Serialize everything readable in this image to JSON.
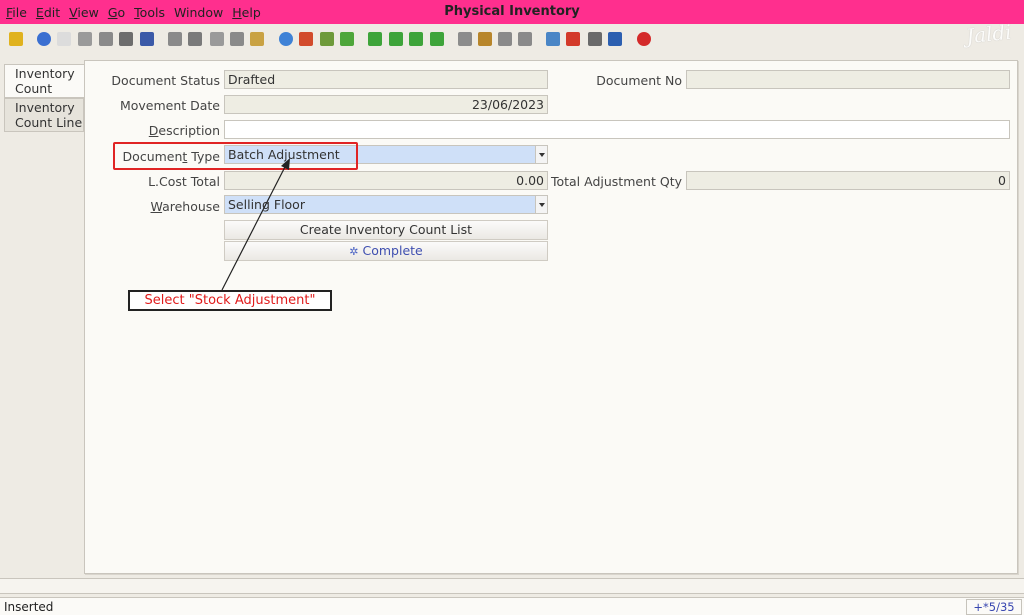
{
  "menu": {
    "items": [
      {
        "mnemonic": "F",
        "rest": "ile"
      },
      {
        "mnemonic": "E",
        "rest": "dit"
      },
      {
        "mnemonic": "V",
        "rest": "iew"
      },
      {
        "mnemonic": "G",
        "rest": "o"
      },
      {
        "mnemonic": "T",
        "rest": "ools"
      },
      {
        "mnemonic": "",
        "rest": "Window"
      },
      {
        "mnemonic": "H",
        "rest": "elp"
      }
    ]
  },
  "window_title": "Physical Inventory",
  "logo_text": "Jaldi",
  "toolbar_icons": [
    {
      "name": "undo-icon",
      "color": "#e0b21e"
    },
    {
      "name": "help-icon",
      "color": "#3a6fd1"
    },
    {
      "name": "new-record-icon",
      "color": "#dcdcdc"
    },
    {
      "name": "copy-record-icon",
      "color": "#9a9a9a"
    },
    {
      "name": "delete-icon",
      "color": "#8a8a8a"
    },
    {
      "name": "delete-selection-icon",
      "color": "#6d6d6d"
    },
    {
      "name": "save-icon",
      "color": "#3b5aa8"
    },
    {
      "name": "refresh-icon",
      "color": "#8a8a8a"
    },
    {
      "name": "find-icon",
      "color": "#7a7a7a"
    },
    {
      "name": "attachment-icon",
      "color": "#9a9a9a"
    },
    {
      "name": "chat-icon",
      "color": "#8a8a8a"
    },
    {
      "name": "grid-toggle-icon",
      "color": "#c9a243"
    },
    {
      "name": "history-icon",
      "color": "#3f82d6"
    },
    {
      "name": "home-icon",
      "color": "#d24b2c"
    },
    {
      "name": "previous-icon",
      "color": "#6e9a3a"
    },
    {
      "name": "next-icon",
      "color": "#4ea63a"
    },
    {
      "name": "first-record-icon",
      "color": "#3ea43a"
    },
    {
      "name": "previous-record-icon",
      "color": "#3ea43a"
    },
    {
      "name": "next-record-icon",
      "color": "#3ea43a"
    },
    {
      "name": "last-record-icon",
      "color": "#3ea43a"
    },
    {
      "name": "report-icon",
      "color": "#8c8c8c"
    },
    {
      "name": "archive-icon",
      "color": "#b8862b"
    },
    {
      "name": "print-preview-icon",
      "color": "#8a8a8a"
    },
    {
      "name": "print-icon",
      "color": "#8a8a8a"
    },
    {
      "name": "zoom-across-icon",
      "color": "#4a86c6"
    },
    {
      "name": "workflow-icon",
      "color": "#d33a2a"
    },
    {
      "name": "product-info-icon",
      "color": "#6a6a6a"
    },
    {
      "name": "end-icon",
      "color": "#2c5fb0"
    },
    {
      "name": "close-window-icon",
      "color": "#d42a2a"
    }
  ],
  "tabs": [
    {
      "label_line1": "Inventory",
      "label_line2": "Count"
    },
    {
      "label_line1": "Inventory",
      "label_line2": "Count Line"
    }
  ],
  "form": {
    "document_status_label": "Document Status",
    "document_status_value": "Drafted",
    "document_no_label": "Document No",
    "document_no_value": "",
    "movement_date_label": "Movement Date",
    "movement_date_value": "23/06/2023",
    "description_label_mnemonic": "D",
    "description_label_rest": "escription",
    "description_value": "",
    "document_type_label_pre": "Documen",
    "document_type_label_mnemonic": "t",
    "document_type_label_post": " Type",
    "document_type_value": "Batch Adjustment",
    "lcost_total_label": "L.Cost Total",
    "lcost_total_value": "0.00",
    "total_adjustment_qty_label": "Total Adjustment Qty",
    "total_adjustment_qty_value": "0",
    "warehouse_label_mnemonic": "W",
    "warehouse_label_rest": "arehouse",
    "warehouse_value": "Selling Floor",
    "create_list_button": "Create Inventory Count List",
    "complete_button": "Complete"
  },
  "annotation": {
    "callout_text": "Select \"Stock Adjustment\"",
    "highlight_color": "#e02424"
  },
  "status": {
    "text": "Inserted",
    "record_info": "+*5/35"
  }
}
